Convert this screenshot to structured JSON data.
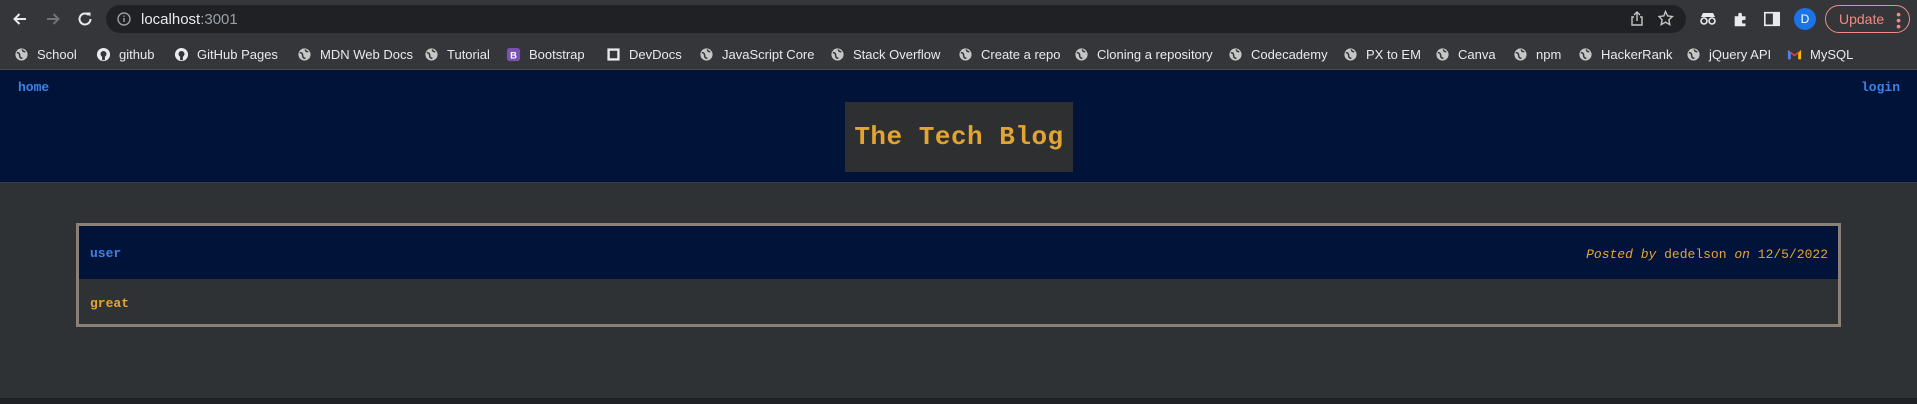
{
  "browser": {
    "url_host": "localhost",
    "url_port": ":3001",
    "profile_initial": "D",
    "update_label": "Update",
    "bookmarks": [
      {
        "label": "School",
        "icon": "globe-icon"
      },
      {
        "label": "github",
        "icon": "github-icon"
      },
      {
        "label": "GitHub Pages",
        "icon": "github-icon"
      },
      {
        "label": "MDN Web Docs",
        "icon": "globe-icon"
      },
      {
        "label": "Tutorial",
        "icon": "globe-icon"
      },
      {
        "label": "Bootstrap",
        "icon": "bootstrap-icon"
      },
      {
        "label": "DevDocs",
        "icon": "devdocs-icon"
      },
      {
        "label": "JavaScript Core",
        "icon": "globe-icon"
      },
      {
        "label": "Stack Overflow",
        "icon": "globe-icon"
      },
      {
        "label": "Create a repo",
        "icon": "globe-icon"
      },
      {
        "label": "Cloning a repository",
        "icon": "globe-icon"
      },
      {
        "label": "Codecademy",
        "icon": "globe-icon"
      },
      {
        "label": "PX to EM",
        "icon": "globe-icon"
      },
      {
        "label": "Canva",
        "icon": "globe-icon"
      },
      {
        "label": "npm",
        "icon": "globe-icon"
      },
      {
        "label": "HackerRank",
        "icon": "globe-icon"
      },
      {
        "label": "jQuery API",
        "icon": "globe-icon"
      },
      {
        "label": "MySQL",
        "icon": "gmail-icon"
      }
    ]
  },
  "header": {
    "home_link": "home",
    "login_link": "login",
    "title": "The Tech Blog"
  },
  "post": {
    "title": "user",
    "posted_by_prefix": "Posted by",
    "author": "dedelson",
    "on_word": "on",
    "date": "12/5/2022",
    "body": "great"
  },
  "colors": {
    "header_bg": "#02133a",
    "page_bg": "#2f3235",
    "link_blue": "#3b82e6",
    "accent_gold": "#e3a532"
  }
}
